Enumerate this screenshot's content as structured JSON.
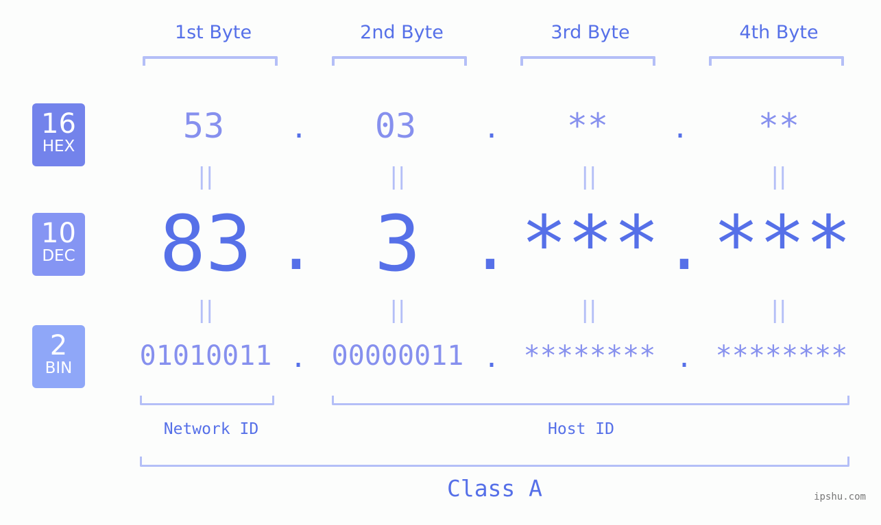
{
  "bytes_header": [
    "1st Byte",
    "2nd Byte",
    "3rd Byte",
    "4th Byte"
  ],
  "badges": [
    {
      "num": "16",
      "label": "HEX",
      "color": "#7383eb"
    },
    {
      "num": "10",
      "label": "DEC",
      "color": "#8595f3"
    },
    {
      "num": "2",
      "label": "BIN",
      "color": "#8fa7f8"
    }
  ],
  "hex": [
    "53",
    "03",
    "**",
    "**"
  ],
  "dec": [
    "83",
    "3",
    "***",
    "***"
  ],
  "bin": [
    "01010011",
    "00000011",
    "********",
    "********"
  ],
  "separator": ".",
  "equals": "=",
  "network_label": "Network ID",
  "host_label": "Host ID",
  "class_label": "Class A",
  "watermark": "ipshu.com",
  "colors": {
    "accent": "#5670e8",
    "light": "#8690ee",
    "bracket": "#b4bff7"
  }
}
